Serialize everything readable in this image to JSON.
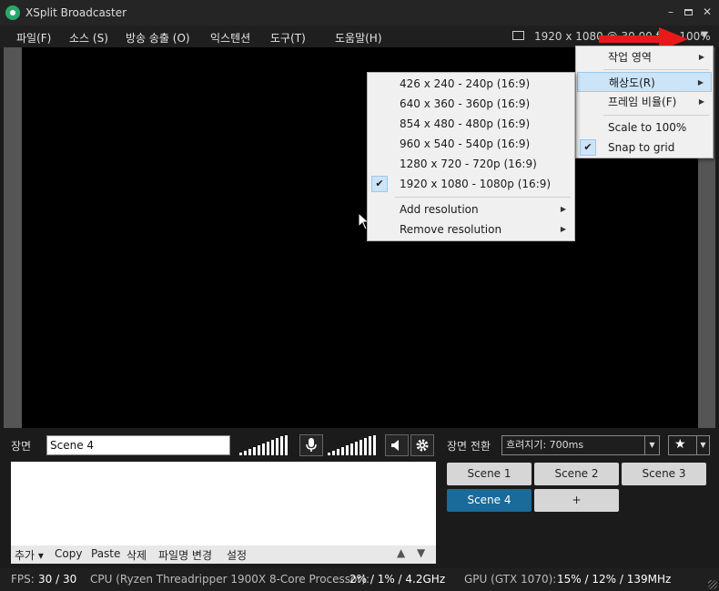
{
  "window": {
    "title": "XSplit Broadcaster"
  },
  "menubar": {
    "items": [
      "파일(F)",
      "소스 (S)",
      "방송 송출 (O)",
      "익스텐션",
      "도구(T)",
      "도움말(H)"
    ],
    "resolution_display": "1920 x 1080 @ 30.00 fps, 100%"
  },
  "view_menu": {
    "items": [
      {
        "label": "작업 영역",
        "submenu": true,
        "checked": false
      },
      {
        "label": "해상도(R)",
        "submenu": true,
        "checked": false,
        "highlighted": true
      },
      {
        "label": "프레임 비율(F)",
        "submenu": true,
        "checked": false
      },
      {
        "label": "Scale to 100%",
        "submenu": false,
        "checked": false
      },
      {
        "label": "Snap to grid",
        "submenu": false,
        "checked": true
      }
    ]
  },
  "resolution_menu": {
    "items": [
      {
        "label": "426 x 240 - 240p (16:9)",
        "checked": false
      },
      {
        "label": "640 x 360 - 360p (16:9)",
        "checked": false
      },
      {
        "label": "854 x 480 - 480p (16:9)",
        "checked": false
      },
      {
        "label": "960 x 540 - 540p (16:9)",
        "checked": false
      },
      {
        "label": "1280 x 720 - 720p (16:9)",
        "checked": false
      },
      {
        "label": "1920 x 1080 - 1080p (16:9)",
        "checked": true
      }
    ],
    "extra": [
      {
        "label": "Add resolution",
        "submenu": true
      },
      {
        "label": "Remove resolution",
        "submenu": true
      }
    ]
  },
  "scene_panel": {
    "label": "장면",
    "scene_name": "Scene 4",
    "toolbar": [
      "추가 ▾",
      "Copy",
      "Paste",
      "삭제",
      "파일명 변경",
      "설정"
    ]
  },
  "transition": {
    "label": "장면 전환",
    "value": "흐려지기: 700ms"
  },
  "scenes": [
    {
      "label": "Scene 1",
      "active": false
    },
    {
      "label": "Scene 2",
      "active": false
    },
    {
      "label": "Scene 3",
      "active": false
    },
    {
      "label": "Scene 4",
      "active": true
    },
    {
      "label": "+",
      "active": false
    }
  ],
  "status": {
    "fps_label": "FPS:",
    "fps_value": "30 / 30",
    "cpu_label": "CPU (Ryzen Threadripper 1900X 8-Core Processor):",
    "cpu_value": "2% / 1% / 4.2GHz",
    "gpu_label": "GPU (GTX 1070):",
    "gpu_value": "15% / 12% / 139MHz"
  },
  "colors": {
    "accent": "#1a6a9a",
    "highlight": "#cce4f7",
    "annotation_arrow": "#e8191a"
  },
  "icons": [
    "xsplit-logo-icon",
    "monitor-icon",
    "microphone-icon",
    "speaker-icon",
    "gear-icon",
    "star-add-icon",
    "up-arrow-icon",
    "down-arrow-icon"
  ]
}
